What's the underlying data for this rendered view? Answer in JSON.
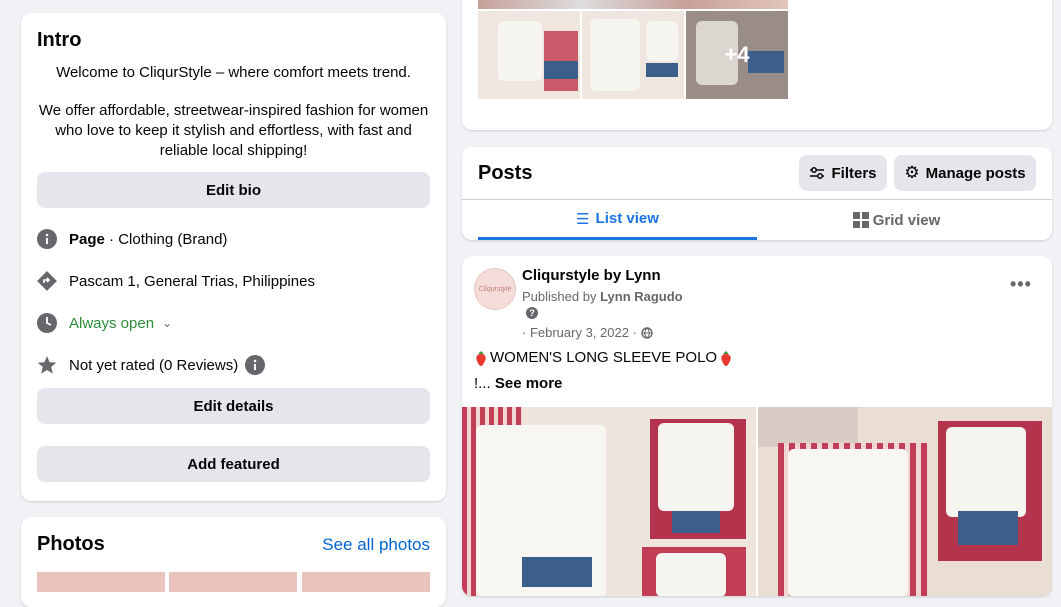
{
  "intro": {
    "title": "Intro",
    "welcome": "Welcome to CliqurStyle – where comfort meets trend.",
    "description": "We offer affordable, streetwear-inspired fashion for women who love to keep it stylish and effortless, with fast and reliable local shipping!",
    "edit_bio": "Edit bio",
    "page_label": "Page",
    "category": " · Clothing (Brand)",
    "address": "Pascam 1, General Trias, Philippines",
    "hours": "Always open",
    "rating": "Not yet rated (0 Reviews)",
    "edit_details": "Edit details",
    "add_featured": "Add featured"
  },
  "photos": {
    "title": "Photos",
    "see_all": "See all photos",
    "more_count": "+4"
  },
  "posts_header": {
    "title": "Posts",
    "filters": "Filters",
    "manage": "Manage posts",
    "list_view": "List view",
    "grid_view": "Grid view"
  },
  "post": {
    "author": "Cliqurstyle by Lynn",
    "published_prefix": "Published by ",
    "publisher": "Lynn Ragudo",
    "date": "· February 3, 2022 ·",
    "text": "WOMEN'S LONG SLEEVE POLO",
    "prefix": "!...",
    "see_more": "See more",
    "avatar_text": "Cliqurstyle"
  },
  "colors": {
    "link_blue": "#0064d1",
    "active_tab": "#1b74e4",
    "open_green": "#2e8b3a",
    "icon_gray": "#65676b"
  }
}
